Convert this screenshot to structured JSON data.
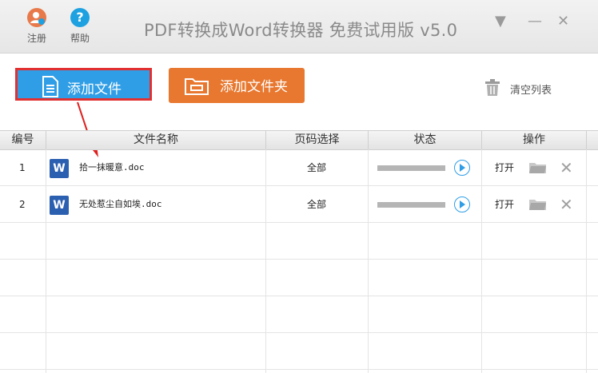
{
  "titlebar": {
    "register_label": "注册",
    "help_label": "帮助",
    "title": "PDF转换成Word转换器 免费试用版 v5.0",
    "help_glyph": "?",
    "dropdown_glyph": "▼",
    "minimize_glyph": "—",
    "close_glyph": "✕"
  },
  "toolbar": {
    "add_file_label": "添加文件",
    "add_folder_label": "添加文件夹",
    "clear_label": "清空列表"
  },
  "table": {
    "headers": [
      "编号",
      "文件名称",
      "页码选择",
      "状态",
      "操作"
    ],
    "rows": [
      {
        "index": "1",
        "file": "拾一抹暖意.doc",
        "pages": "全部",
        "progress": 0,
        "open": "打开",
        "file_icon": "W"
      },
      {
        "index": "2",
        "file": "无处惹尘自如埃.doc",
        "pages": "全部",
        "progress": 0,
        "open": "打开",
        "file_icon": "W"
      }
    ],
    "delete_glyph": "✕"
  },
  "colors": {
    "accent_blue": "#2f9ee6",
    "accent_orange": "#e8782f",
    "highlight_red": "#e23030",
    "word_blue": "#2b5fb0"
  },
  "icons": [
    "user-icon",
    "help-icon",
    "document-icon",
    "folder-icon",
    "trash-icon",
    "play-icon",
    "word-file-icon",
    "close-icon",
    "dropdown-icon",
    "minimize-icon",
    "arrow-pointer-icon"
  ]
}
